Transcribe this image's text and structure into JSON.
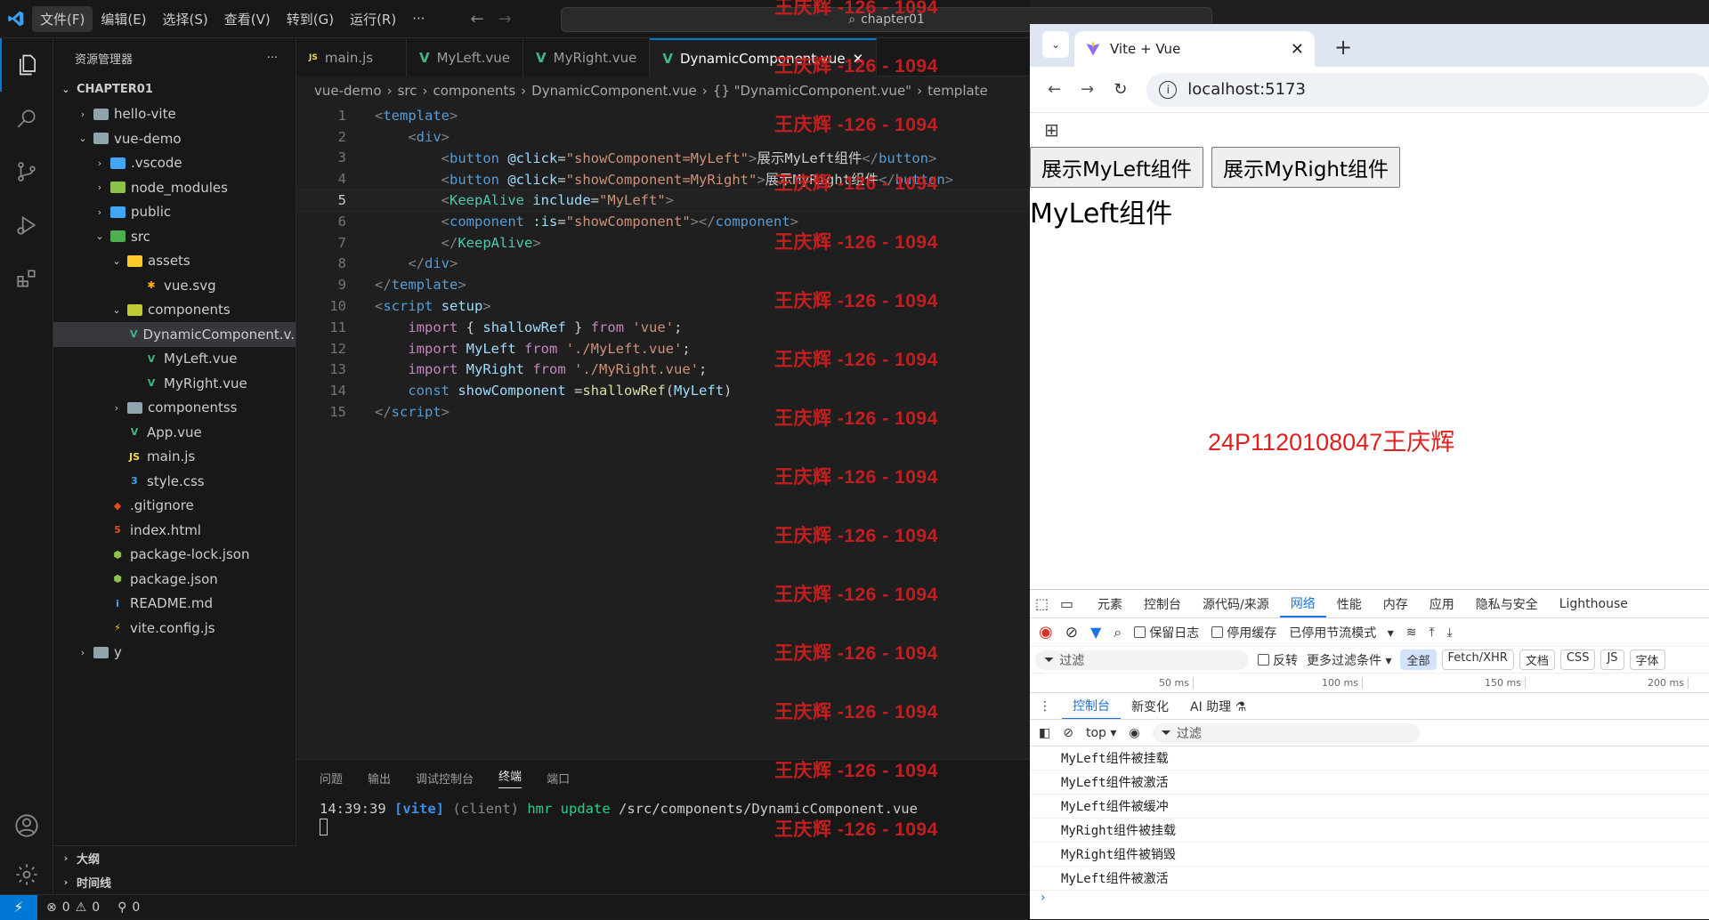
{
  "vscode": {
    "menu": [
      "文件(F)",
      "编辑(E)",
      "选择(S)",
      "查看(V)",
      "转到(G)",
      "运行(R)",
      "···"
    ],
    "search_text": "chapter01",
    "explorer_title": "资源管理器",
    "explorer_more": "···",
    "tree": [
      {
        "label": "CHAPTER01",
        "depth": 0,
        "chev": "⌄",
        "type": "root"
      },
      {
        "label": "hello-vite",
        "depth": 1,
        "chev": "›",
        "type": "folder",
        "color": "#90a4ae"
      },
      {
        "label": "vue-demo",
        "depth": 1,
        "chev": "⌄",
        "type": "folder",
        "color": "#90a4ae"
      },
      {
        "label": ".vscode",
        "depth": 2,
        "chev": "›",
        "type": "folder",
        "color": "#42a5f5"
      },
      {
        "label": "node_modules",
        "depth": 2,
        "chev": "›",
        "type": "folder",
        "color": "#8bc34a"
      },
      {
        "label": "public",
        "depth": 2,
        "chev": "›",
        "type": "folder",
        "color": "#42a5f5"
      },
      {
        "label": "src",
        "depth": 2,
        "chev": "⌄",
        "type": "folder",
        "color": "#4caf50"
      },
      {
        "label": "assets",
        "depth": 3,
        "chev": "⌄",
        "type": "folder",
        "color": "#ffca28"
      },
      {
        "label": "vue.svg",
        "depth": 4,
        "chev": "",
        "type": "file",
        "icon": "✱",
        "color": "#ffb300"
      },
      {
        "label": "components",
        "depth": 3,
        "chev": "⌄",
        "type": "folder",
        "color": "#c0ca33"
      },
      {
        "label": "DynamicComponent.v...",
        "depth": 4,
        "chev": "",
        "type": "file",
        "icon": "V",
        "color": "#41b883",
        "selected": true
      },
      {
        "label": "MyLeft.vue",
        "depth": 4,
        "chev": "",
        "type": "file",
        "icon": "V",
        "color": "#41b883"
      },
      {
        "label": "MyRight.vue",
        "depth": 4,
        "chev": "",
        "type": "file",
        "icon": "V",
        "color": "#41b883"
      },
      {
        "label": "componentss",
        "depth": 3,
        "chev": "›",
        "type": "folder",
        "color": "#90a4ae"
      },
      {
        "label": "App.vue",
        "depth": 3,
        "chev": "",
        "type": "file",
        "icon": "V",
        "color": "#41b883"
      },
      {
        "label": "main.js",
        "depth": 3,
        "chev": "",
        "type": "file",
        "icon": "JS",
        "color": "#f0db4f"
      },
      {
        "label": "style.css",
        "depth": 3,
        "chev": "",
        "type": "file",
        "icon": "3",
        "color": "#42a5f5"
      },
      {
        "label": ".gitignore",
        "depth": 2,
        "chev": "",
        "type": "file",
        "icon": "◆",
        "color": "#e64a19"
      },
      {
        "label": "index.html",
        "depth": 2,
        "chev": "",
        "type": "file",
        "icon": "5",
        "color": "#e44d26"
      },
      {
        "label": "package-lock.json",
        "depth": 2,
        "chev": "",
        "type": "file",
        "icon": "⬢",
        "color": "#8bc34a"
      },
      {
        "label": "package.json",
        "depth": 2,
        "chev": "",
        "type": "file",
        "icon": "⬢",
        "color": "#8bc34a"
      },
      {
        "label": "README.md",
        "depth": 2,
        "chev": "",
        "type": "file",
        "icon": "i",
        "color": "#42a5f5"
      },
      {
        "label": "vite.config.js",
        "depth": 2,
        "chev": "",
        "type": "file",
        "icon": "⚡",
        "color": "#ffca28"
      },
      {
        "label": "y",
        "depth": 1,
        "chev": "›",
        "type": "folder",
        "color": "#90a4ae"
      }
    ],
    "outline_label": "大纲",
    "timeline_label": "时间线",
    "tabs": [
      {
        "label": "main.js",
        "icon": "JS",
        "color": "#f0db4f"
      },
      {
        "label": "MyLeft.vue",
        "icon": "V",
        "color": "#41b883"
      },
      {
        "label": "MyRight.vue",
        "icon": "V",
        "color": "#41b883"
      },
      {
        "label": "DynamicComponent.vue",
        "icon": "V",
        "color": "#41b883",
        "active": true
      }
    ],
    "breadcrumb": [
      "vue-demo",
      "src",
      "components",
      "DynamicComponent.vue",
      "{} \"DynamicComponent.vue\"",
      "template"
    ],
    "current_line": 5,
    "panel_tabs": [
      "问题",
      "输出",
      "调试控制台",
      "终端",
      "端口"
    ],
    "panel_active": "终端",
    "terminal": {
      "time": "14:39:39",
      "tag": "[vite]",
      "client": "(client)",
      "hmr": "hmr update",
      "path": "/src/components/DynamicComponent.vue"
    },
    "status": {
      "errors": "0",
      "warnings": "0",
      "ports": "0"
    }
  },
  "watermark": {
    "text": "王庆辉 -126 - 1094",
    "count": 15
  },
  "browser": {
    "tab_title": "Vite + Vue",
    "url": "localhost:5173",
    "page": {
      "buttons": [
        "展示MyLeft组件",
        "展示MyRight组件"
      ],
      "content": "MyLeft组件",
      "student": "24P1120108047王庆辉"
    },
    "devtools": {
      "tabs": [
        "元素",
        "控制台",
        "源代码/来源",
        "网络",
        "性能",
        "内存",
        "应用",
        "隐私与安全",
        "Lighthouse"
      ],
      "active_tab": "网络",
      "preserve_log": "保留日志",
      "disable_cache": "停用缓存",
      "throttle": "已停用节流模式",
      "filter_placeholder": "过滤",
      "invert": "反转",
      "more_filters": "更多过滤条件",
      "type_filters": [
        "全部",
        "Fetch/XHR",
        "文档",
        "CSS",
        "JS",
        "字体"
      ],
      "timeline": [
        "50 ms",
        "100 ms",
        "150 ms",
        "200 ms"
      ],
      "drawer_tabs": [
        "控制台",
        "新变化",
        "AI 助理 ⚗"
      ],
      "context": "top",
      "console_filter": "过滤",
      "logs": [
        "MyLeft组件被挂载",
        "MyLeft组件被激活",
        "MyLeft组件被缓冲",
        "MyRight组件被挂载",
        "MyRight组件被销毁",
        "MyLeft组件被激活"
      ]
    }
  }
}
